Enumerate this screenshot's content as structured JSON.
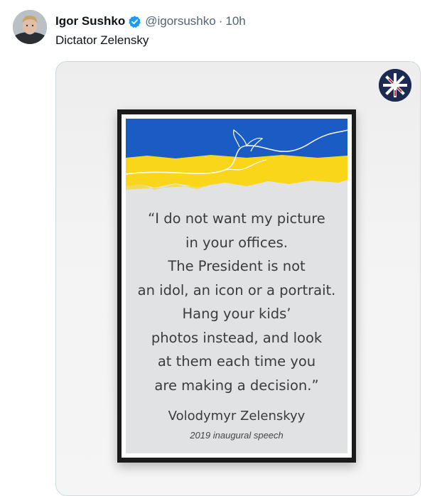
{
  "tweet": {
    "display_name": "Igor Sushko",
    "handle": "@igorsushko",
    "separator": "·",
    "time": "10h",
    "text": "Dictator Zelensky",
    "verified_color": "#1d9bf0"
  },
  "poster": {
    "quote_lines": [
      "“I do not want my picture",
      "in your offices.",
      "The President is not",
      "an idol, an icon or a portrait.",
      "Hang your kids’",
      "photos instead, and look",
      "at them each time you",
      "are making a decision.”"
    ],
    "author": "Volodymyr Zelenskyy",
    "caption": "2019 inaugural speech",
    "flag_colors": {
      "blue": "#1a5bc4",
      "yellow": "#f9d61a"
    }
  },
  "icons": {
    "verified": "verified-badge-icon",
    "watermark": "union-jack-logo-icon"
  }
}
